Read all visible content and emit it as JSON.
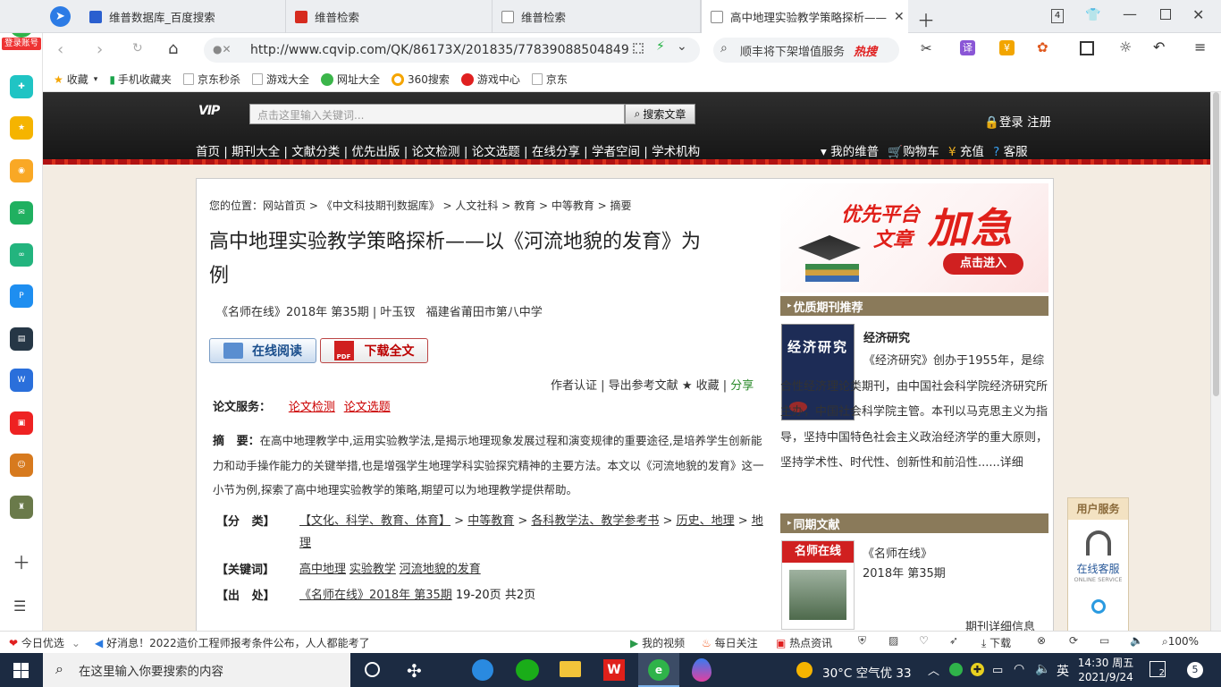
{
  "browser": {
    "tabs": [
      {
        "title": "维普数据库_百度搜索"
      },
      {
        "title": "维普检索"
      },
      {
        "title": "维普检索"
      },
      {
        "title": "高中地理实验教学策略探析——"
      }
    ],
    "tab_count": "4",
    "url": "http://www.cqvip.com/QK/86173X/201835/77839088504849",
    "search_placeholder": "顺丰将下架增值服务",
    "search_hot": "热搜",
    "login_label": "登录账号",
    "bookmarks": [
      "收藏",
      "手机收藏夹",
      "京东秒杀",
      "游戏大全",
      "网址大全",
      "360搜索",
      "游戏中心",
      "京东"
    ]
  },
  "vip": {
    "search_placeholder": "点击这里输入关键词...",
    "search_button": "搜索文章",
    "login": "登录 注册",
    "nav": [
      "首页",
      "期刊大全",
      "文献分类",
      "优先出版",
      "论文检测",
      "论文选题",
      "在线分享",
      "学者空间",
      "学术机构"
    ],
    "right_nav": [
      "我的维普",
      "购物车",
      "充值",
      "客服"
    ]
  },
  "article": {
    "breadcrumb_label": "您的位置：",
    "breadcrumb": [
      "网站首页",
      "《中文科技期刊数据库》",
      "人文社科",
      "教育",
      "中等教育",
      "摘要"
    ],
    "title_line1": "高中地理实验教学策略探析——以《河流地貌的发育》为",
    "title_line2": "例",
    "meta": "《名师在线》2018年 第35期 | 叶玉钗   福建省莆田市第八中学",
    "read_online": "在线阅读",
    "download": "下载全文",
    "actions": [
      "作者认证",
      "导出参考文献",
      "收藏",
      "分享"
    ],
    "service_label": "论文服务：",
    "services": [
      "论文检测",
      "论文选题"
    ],
    "abstract_label": "摘   要：",
    "abstract": "在高中地理教学中,运用实验教学法,是揭示地理现象发展过程和演变规律的重要途径,是培养学生创新能力和动手操作能力的关键举措,也是增强学生地理学科实验探究精神的主要方法。本文以《河流地貌的发育》这一小节为例,探索了高中地理实验教学的策略,期望可以为地理教学提供帮助。",
    "class_label": "【分   类】",
    "class_items": [
      "【文化、科学、教育、体育】",
      "中等教育",
      "各科教学法、教学参考书",
      "历史、地理",
      "地理"
    ],
    "keyword_label": "【关键词】",
    "keywords": [
      "高中地理",
      "实验教学",
      "河流地貌的发育"
    ],
    "source_label": "【出   处】",
    "source_link": "《名师在线》2018年 第35期",
    "source_pages": "19-20页 共2页"
  },
  "side": {
    "banner_line1": "优先平台",
    "banner_line2": "文章",
    "banner_big": "加急",
    "banner_btn": "点击进入",
    "journal_section": "优质期刊推荐",
    "journal_name": "经济研究",
    "journal_cover": "经济研究",
    "journal_desc": "《经济研究》创办于1955年，是综合性经济理论类期刊，由中国社会科学院经济研究所主办，中国社会科学院主管。本刊以马克思主义为指导，坚持中国特色社会主义政治经济学的重大原则，坚持学术性、时代性、创新性和前沿性......详细",
    "same_section": "同期文献",
    "same_journal": "《名师在线》",
    "same_issue": "2018年 第35期",
    "same_cover": "名师在线",
    "same_more": "期刊详细信息",
    "user_service": "用户服务",
    "online_service": "在线客服",
    "online_service_en": "ONLINE SERVICE"
  },
  "statusbar": {
    "today": "今日优选",
    "news": "好消息！2022造价工程师报考条件公布，人人都能考了",
    "items": [
      "我的视频",
      "每日关注",
      "热点资讯",
      "下载"
    ],
    "zoom": "100%"
  },
  "taskbar": {
    "search_placeholder": "在这里输入你要搜索的内容",
    "weather": "30°C 空气优 33",
    "ime": "英",
    "time": "14:30 周五",
    "date": "2021/9/24",
    "notif": "2",
    "badge": "5"
  },
  "colors": {
    "vip_red": "#b01212",
    "brown": "#8a7a5a",
    "accent_red": "#cc0000"
  }
}
